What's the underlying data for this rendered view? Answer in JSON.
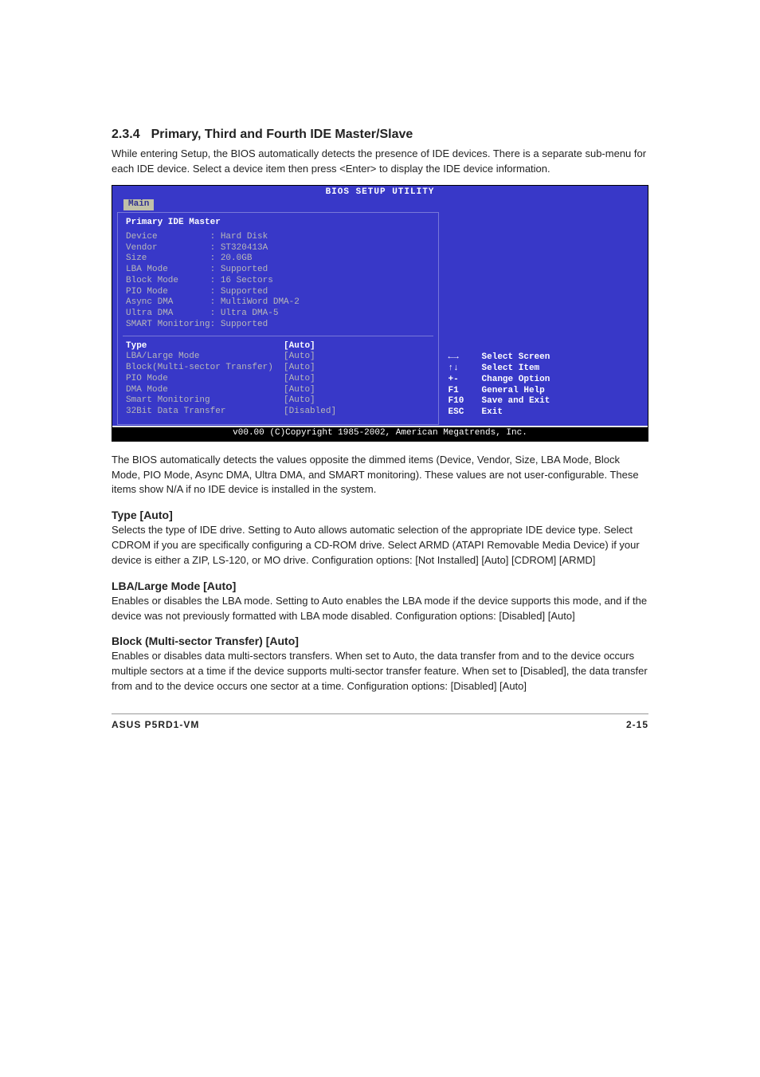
{
  "section": {
    "number": "2.3.4",
    "title": "Primary, Third and Fourth IDE Master/Slave",
    "intro": "While entering Setup, the BIOS automatically detects the presence of IDE devices. There is a separate sub-menu for each IDE device. Select a device item then press <Enter> to display the IDE device information."
  },
  "bios": {
    "header": "BIOS SETUP UTILITY",
    "tab": "Main",
    "panel_title": "Primary IDE Master",
    "info": {
      "Device": "Hard Disk",
      "Vendor": "ST320413A",
      "Size": "20.0GB",
      "LBA Mode": "Supported",
      "Block Mode": "16 Sectors",
      "PIO Mode": "Supported",
      "Async DMA": "MultiWord DMA-2",
      "Ultra DMA": "Ultra DMA-5",
      "SMART Monitoring": "Supported"
    },
    "settings": [
      {
        "label": "Type",
        "value": "[Auto]",
        "selected": true
      },
      {
        "label": "LBA/Large Mode",
        "value": "[Auto]"
      },
      {
        "label": "Block(Multi-sector Transfer)",
        "value": "[Auto]"
      },
      {
        "label": "PIO Mode",
        "value": "[Auto]"
      },
      {
        "label": "DMA Mode",
        "value": "[Auto]"
      },
      {
        "label": "Smart Monitoring",
        "value": "[Auto]"
      },
      {
        "label": "32Bit Data Transfer",
        "value": "[Disabled]"
      }
    ],
    "help": [
      {
        "key": "←→",
        "label": "Select Screen"
      },
      {
        "key": "↑↓",
        "label": "Select Item"
      },
      {
        "key": "+-",
        "label": "Change Option"
      },
      {
        "key": "F1",
        "label": "General Help"
      },
      {
        "key": "F10",
        "label": "Save and Exit"
      },
      {
        "key": "ESC",
        "label": "Exit"
      }
    ],
    "footer": "v00.00 (C)Copyright 1985-2002, American Megatrends, Inc."
  },
  "after_bios": "The BIOS automatically detects the values opposite the dimmed items (Device, Vendor, Size, LBA Mode, Block Mode, PIO Mode, Async DMA, Ultra DMA, and SMART monitoring). These values are not user-configurable. These items show N/A if no IDE device is installed in the system.",
  "blocks": {
    "type": {
      "heading": "Type [Auto]",
      "body": "Selects the type of IDE drive. Setting to Auto allows automatic selection of the appropriate IDE device type. Select CDROM if you are specifically configuring a CD-ROM drive. Select ARMD (ATAPI Removable Media Device) if your device is either a ZIP, LS-120, or MO drive. Configuration options: [Not Installed] [Auto] [CDROM] [ARMD]"
    },
    "lba": {
      "heading": "LBA/Large Mode [Auto]",
      "body": "Enables or disables the LBA mode. Setting to Auto enables the LBA mode if the device supports this mode, and if the device was not previously formatted with LBA mode disabled. Configuration options: [Disabled] [Auto]"
    },
    "block": {
      "heading": "Block (Multi-sector Transfer) [Auto]",
      "body": "Enables or disables data multi-sectors transfers. When set to Auto, the data transfer from and to the device occurs multiple sectors at a time if the device supports multi-sector transfer feature. When set to [Disabled], the data transfer from and to the device occurs one sector at a time. Configuration options: [Disabled] [Auto]"
    }
  },
  "footer": {
    "left": "ASUS P5RD1-VM",
    "right": "2-15"
  }
}
